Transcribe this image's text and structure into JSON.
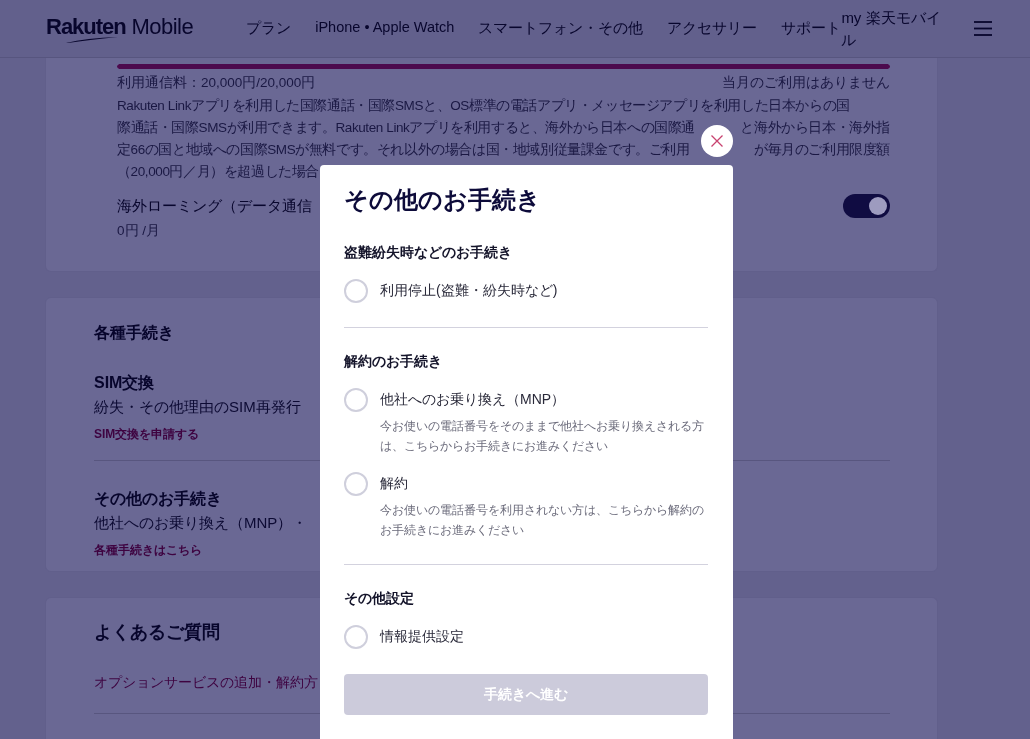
{
  "header": {
    "logo": "**Rakuten** Mobile",
    "nav": [
      {
        "label": "プラン"
      },
      {
        "label": "iPhone • Apple Watch"
      },
      {
        "label": "スマートフォン・その他"
      },
      {
        "label": "アクセサリー"
      },
      {
        "label": "サポート"
      }
    ],
    "account_link": "my 楽天モバイル"
  },
  "usage": {
    "meter": {
      "level": 1
    },
    "fee_label": "利用通信料：20,000円/20,000円",
    "status": "当月のご利用はありません",
    "description_lines": [
      [
        "Rakuten Linkアプリを利用した国際通話・国際SMSと、OS標準の電話アプリ・メッセージアプリを利用した日本からの国"
      ],
      [
        "際通話・国際SMSが利用できます。Rakuten Linkアプリを利用すると、海外から日本への国際通",
        "と海外から日本・海外指"
      ],
      [
        "定66の国と地域への国際SMSが無料です。それ以外の場合は国・地域別従量課金です。ご利用",
        "が毎月のご利用限度額"
      ],
      [
        "（20,000円／月）を超過した場合"
      ]
    ],
    "roaming": {
      "label": "海外ローミング（データ通信",
      "price": "0円 /月",
      "on": true
    }
  },
  "procedures": {
    "title": "各種手続き",
    "items": [
      {
        "title": "SIM交換",
        "text": "紛失・その他理由のSIM再発行",
        "link": "SIM交換を申請する"
      },
      {
        "title": "その他のお手続き",
        "text": "他社へのお乗り換え（MNP）・",
        "link": "各種手続きはこちら"
      }
    ]
  },
  "faq": {
    "title": "よくあるご質問",
    "links": [
      "オプションサービスの追加・解約方"
    ]
  },
  "modal": {
    "title": "その他のお手続き",
    "sections": [
      {
        "heading": "盗難紛失時などのお手続き",
        "options": [
          {
            "label": "利用停止(盗難・紛失時など)",
            "selected": false
          }
        ]
      },
      {
        "heading": "解約のお手続き",
        "options": [
          {
            "label": "他社へのお乗り換え（MNP）",
            "description": "今お使いの電話番号をそのままで他社へお乗り換えされる方は、こちらからお手続きにお進みください",
            "selected": false
          },
          {
            "label": "解約",
            "description": "今お使いの電話番号を利用されない方は、こちらから解約のお手続きにお進みください",
            "selected": false
          }
        ]
      },
      {
        "heading": "その他設定",
        "options": [
          {
            "label": "情報提供設定",
            "selected": false
          }
        ]
      }
    ],
    "submit": {
      "label": "手続きへ進む",
      "disabled": true
    }
  }
}
